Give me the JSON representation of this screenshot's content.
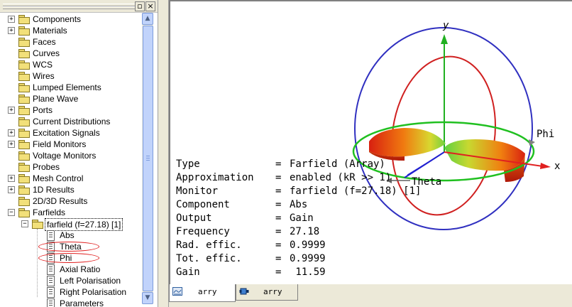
{
  "window_controls": {
    "restore": "▫",
    "close": "×"
  },
  "tree": {
    "items": [
      {
        "label": "Components",
        "expandable": true
      },
      {
        "label": "Materials",
        "expandable": true
      },
      {
        "label": "Faces",
        "expandable": false
      },
      {
        "label": "Curves",
        "expandable": false
      },
      {
        "label": "WCS",
        "expandable": false
      },
      {
        "label": "Wires",
        "expandable": false
      },
      {
        "label": "Lumped Elements",
        "expandable": false
      },
      {
        "label": "Plane Wave",
        "expandable": false
      },
      {
        "label": "Ports",
        "expandable": true
      },
      {
        "label": "Current Distributions",
        "expandable": false
      },
      {
        "label": "Excitation Signals",
        "expandable": true
      },
      {
        "label": "Field Monitors",
        "expandable": true
      },
      {
        "label": "Voltage Monitors",
        "expandable": false
      },
      {
        "label": "Probes",
        "expandable": false
      },
      {
        "label": "Mesh Control",
        "expandable": true
      },
      {
        "label": "1D Results",
        "expandable": true
      },
      {
        "label": "2D/3D Results",
        "expandable": false
      },
      {
        "label": "Farfields",
        "expandable": true,
        "expanded": true
      },
      {
        "label": "farfield (f=27.18) [1]",
        "expandable": true,
        "expanded": true,
        "selected": true
      },
      {
        "label": "Abs"
      },
      {
        "label": "Theta",
        "annotated": true
      },
      {
        "label": "Phi",
        "annotated": true
      },
      {
        "label": "Axial Ratio"
      },
      {
        "label": "Left Polarisation"
      },
      {
        "label": "Right Polarisation"
      },
      {
        "label": "Parameters",
        "partial": true
      }
    ]
  },
  "scene": {
    "axes": {
      "x": "x",
      "y": "y",
      "phi": "Phi",
      "theta": "Theta"
    },
    "colors": {
      "x_axis": "#e02020",
      "y_axis": "#20b020",
      "z_axis": "#2020d0",
      "phi_circle": "#20c020",
      "theta_circle": "#d02020",
      "sphere": "#3030c0"
    }
  },
  "info": {
    "rows": [
      {
        "key": "Type",
        "value": "Farfield (Array)"
      },
      {
        "key": "Approximation",
        "value": "enabled (kR >> 1)"
      },
      {
        "key": "Monitor",
        "value": "farfield (f=27.18) [1]"
      },
      {
        "key": "Component",
        "value": "Abs"
      },
      {
        "key": "Output",
        "value": "Gain"
      },
      {
        "key": "Frequency",
        "value": "27.18"
      },
      {
        "key": "Rad. effic.",
        "value": "0.9999"
      },
      {
        "key": "Tot. effic.",
        "value": "0.9999"
      },
      {
        "key": "Gain",
        "value": " 11.59"
      }
    ]
  },
  "tabs": [
    {
      "label": "arry",
      "active": true,
      "icon": "result-tab-icon"
    },
    {
      "label": "arry",
      "active": false,
      "icon": "model-tab-icon"
    }
  ]
}
